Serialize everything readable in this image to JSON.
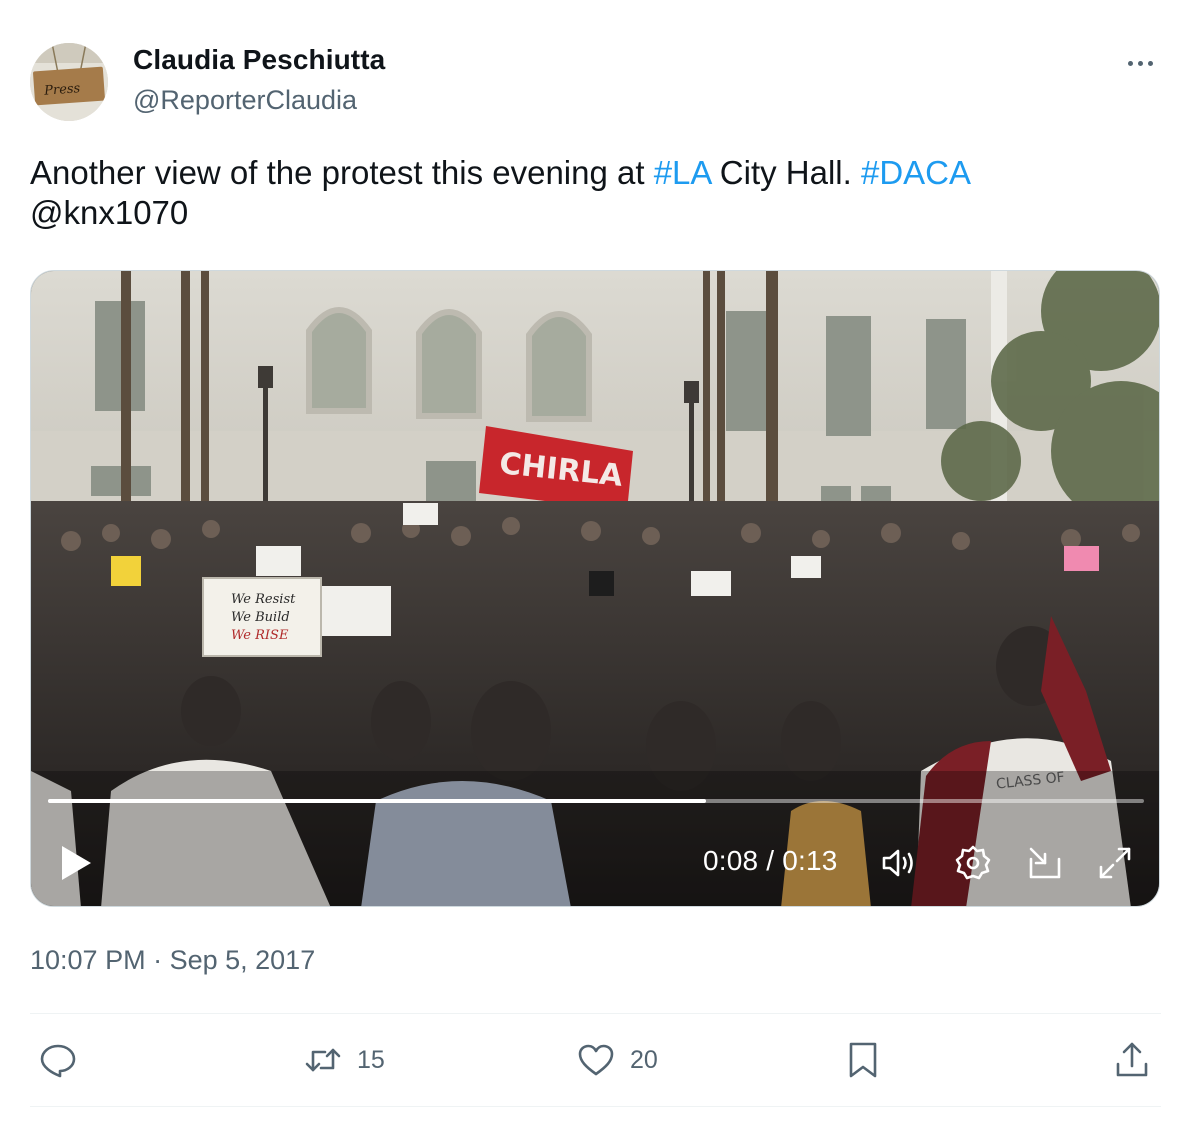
{
  "author": {
    "display_name": "Claudia Peschiutta",
    "handle": "@ReporterClaudia",
    "avatar_sign_text": "Press"
  },
  "tweet": {
    "text_part1": "Another view of the protest this evening at ",
    "hashtag1": "#LA",
    "text_part2": " City Hall. ",
    "hashtag2": "#DACA",
    "mention": "@knx1070"
  },
  "video": {
    "current_time": "0:08",
    "separator": " / ",
    "duration": "0:13",
    "progress_fraction": 0.6,
    "scene_banner_text": "CHIRLA",
    "scene_sign_lines": [
      "We Resist",
      "We Build",
      "We RISE"
    ],
    "scene_shirt_text": "CLASS OF",
    "controls": [
      "play-icon",
      "volume-icon",
      "settings-icon",
      "pip-icon",
      "fullscreen-icon"
    ]
  },
  "timestamp": {
    "time": "10:07 PM",
    "separator": " · ",
    "date": "Sep 5, 2017"
  },
  "actions": {
    "reply_icon": "reply-icon",
    "retweet_count": "15",
    "like_count": "20",
    "bookmark_icon": "bookmark-icon",
    "share_icon": "share-icon"
  },
  "colors": {
    "link": "#1d9bf0",
    "secondary_text": "#536471",
    "primary_text": "#0f1419"
  }
}
